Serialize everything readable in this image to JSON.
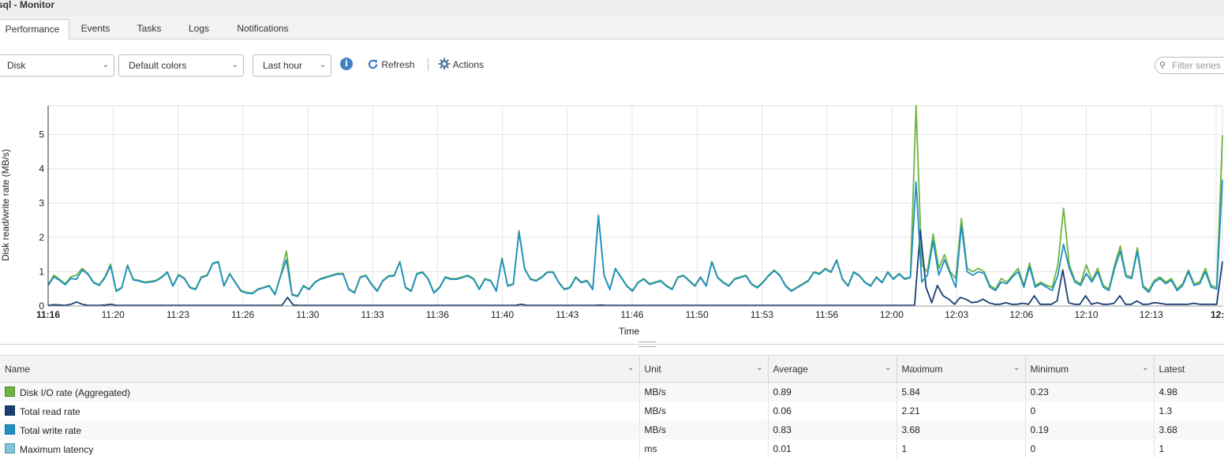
{
  "window": {
    "title": "sql - Monitor"
  },
  "tabs": [
    {
      "label": "Performance",
      "active": true
    },
    {
      "label": "Events",
      "active": false
    },
    {
      "label": "Tasks",
      "active": false
    },
    {
      "label": "Logs",
      "active": false
    },
    {
      "label": "Notifications",
      "active": false
    }
  ],
  "toolbar": {
    "metric_select": "Disk",
    "colors_select": "Default colors",
    "period_select": "Last hour",
    "refresh_label": "Refresh",
    "actions_label": "Actions",
    "filter_placeholder": "Filter series"
  },
  "chart_data": {
    "type": "line",
    "ylabel": "Disk read/write rate (MB/s)",
    "xlabel": "Time",
    "ylim": [
      0,
      5.84
    ],
    "y_ticks": [
      0,
      1,
      2,
      3,
      4,
      5
    ],
    "x_tick_labels": [
      "11:16",
      "11:20",
      "11:23",
      "11:26",
      "11:30",
      "11:33",
      "11:36",
      "11:40",
      "11:43",
      "11:46",
      "11:50",
      "11:53",
      "11:56",
      "12:00",
      "12:03",
      "12:06",
      "12:10",
      "12:13",
      "12:"
    ],
    "grid": true,
    "series": [
      {
        "name": "Disk I/O rate (Aggregated)",
        "color": "#6db33f",
        "values": [
          0.62,
          0.9,
          0.78,
          0.65,
          0.85,
          0.9,
          1.1,
          0.95,
          0.7,
          0.62,
          0.85,
          1.22,
          0.45,
          0.55,
          1.2,
          0.78,
          0.75,
          0.7,
          0.72,
          0.75,
          0.85,
          1.0,
          0.6,
          0.92,
          0.82,
          0.55,
          0.5,
          0.85,
          0.9,
          1.25,
          1.3,
          0.6,
          0.95,
          0.7,
          0.45,
          0.4,
          0.38,
          0.5,
          0.55,
          0.6,
          0.35,
          0.9,
          1.6,
          0.35,
          0.3,
          0.6,
          0.5,
          0.7,
          0.8,
          0.85,
          0.9,
          0.95,
          0.95,
          0.5,
          0.4,
          0.85,
          0.9,
          0.65,
          0.45,
          0.75,
          0.88,
          0.9,
          1.3,
          0.55,
          0.45,
          0.95,
          1.0,
          0.8,
          0.4,
          0.55,
          0.85,
          0.8,
          0.8,
          0.85,
          0.9,
          0.8,
          0.5,
          0.8,
          0.75,
          0.45,
          1.4,
          0.6,
          0.65,
          2.2,
          1.1,
          0.8,
          0.75,
          0.85,
          1.0,
          1.0,
          0.7,
          0.5,
          0.55,
          0.85,
          0.7,
          0.75,
          0.5,
          2.65,
          0.9,
          0.5,
          1.1,
          0.85,
          0.6,
          0.45,
          0.7,
          0.8,
          0.65,
          0.7,
          0.75,
          0.6,
          0.5,
          0.85,
          0.9,
          0.75,
          0.6,
          0.85,
          0.6,
          1.3,
          0.85,
          0.7,
          0.6,
          0.8,
          0.85,
          0.9,
          0.65,
          0.55,
          0.7,
          0.9,
          1.05,
          0.9,
          0.6,
          0.45,
          0.55,
          0.65,
          0.75,
          1.0,
          0.95,
          1.1,
          1.0,
          1.35,
          0.8,
          0.6,
          1.0,
          0.9,
          0.7,
          0.6,
          0.85,
          0.7,
          1.0,
          0.8,
          0.95,
          0.8,
          0.85,
          5.84,
          1.2,
          1.0,
          2.1,
          1.1,
          1.5,
          1.0,
          0.8,
          2.55,
          1.1,
          1.0,
          1.1,
          1.0,
          0.6,
          0.5,
          0.8,
          0.7,
          0.9,
          1.1,
          0.6,
          1.25,
          0.6,
          0.7,
          0.6,
          0.55,
          1.2,
          2.85,
          1.2,
          0.75,
          0.65,
          1.2,
          0.75,
          1.1,
          0.6,
          0.5,
          1.2,
          1.75,
          0.9,
          0.85,
          1.7,
          0.6,
          0.45,
          0.75,
          0.85,
          0.7,
          0.8,
          0.5,
          0.65,
          1.05,
          0.65,
          0.7,
          1.1,
          0.6,
          0.55,
          4.98
        ]
      },
      {
        "name": "Total read rate",
        "color": "#1a3f73",
        "values": [
          0.02,
          0.04,
          0.03,
          0.02,
          0.05,
          0.12,
          0.05,
          0.02,
          0.02,
          0.02,
          0.03,
          0.05,
          0.02,
          0.02,
          0.02,
          0.02,
          0.02,
          0.02,
          0.02,
          0.02,
          0.02,
          0.02,
          0.02,
          0.02,
          0.02,
          0.02,
          0.02,
          0.02,
          0.02,
          0.02,
          0.02,
          0.02,
          0.02,
          0.02,
          0.02,
          0.02,
          0.02,
          0.02,
          0.02,
          0.02,
          0.02,
          0.02,
          0.25,
          0.03,
          0.02,
          0.02,
          0.02,
          0.02,
          0.02,
          0.02,
          0.02,
          0.02,
          0.02,
          0.02,
          0.02,
          0.02,
          0.02,
          0.02,
          0.02,
          0.02,
          0.02,
          0.02,
          0.02,
          0.02,
          0.02,
          0.02,
          0.02,
          0.02,
          0.02,
          0.02,
          0.02,
          0.02,
          0.02,
          0.02,
          0.02,
          0.02,
          0.02,
          0.02,
          0.02,
          0.02,
          0.02,
          0.02,
          0.02,
          0.05,
          0.02,
          0.02,
          0.02,
          0.02,
          0.02,
          0.02,
          0.02,
          0.02,
          0.02,
          0.02,
          0.02,
          0.02,
          0.02,
          0.03,
          0.02,
          0.02,
          0.02,
          0.02,
          0.02,
          0.02,
          0.02,
          0.02,
          0.02,
          0.02,
          0.02,
          0.02,
          0.02,
          0.02,
          0.02,
          0.02,
          0.02,
          0.02,
          0.02,
          0.02,
          0.02,
          0.02,
          0.02,
          0.02,
          0.02,
          0.02,
          0.02,
          0.02,
          0.02,
          0.02,
          0.02,
          0.02,
          0.02,
          0.02,
          0.02,
          0.02,
          0.02,
          0.02,
          0.02,
          0.02,
          0.02,
          0.02,
          0.02,
          0.02,
          0.02,
          0.02,
          0.02,
          0.02,
          0.02,
          0.02,
          0.02,
          0.02,
          0.02,
          0.02,
          0.02,
          2.21,
          0.55,
          0.1,
          0.6,
          0.3,
          0.2,
          0.05,
          0.25,
          0.2,
          0.1,
          0.12,
          0.2,
          0.1,
          0.05,
          0.05,
          0.1,
          0.05,
          0.05,
          0.08,
          0.05,
          0.3,
          0.05,
          0.05,
          0.05,
          0.15,
          1.05,
          0.1,
          0.05,
          0.05,
          0.3,
          0.05,
          0.1,
          0.05,
          0.05,
          0.08,
          0.3,
          0.05,
          0.05,
          0.15,
          0.05,
          0.05,
          0.1,
          0.08,
          0.05,
          0.05,
          0.05,
          0.05,
          0.05,
          0.08,
          0.05,
          0.05,
          0.05,
          0.05,
          1.3
        ]
      },
      {
        "name": "Total write rate",
        "color": "#1e8fc6",
        "values": [
          0.6,
          0.85,
          0.75,
          0.62,
          0.8,
          0.78,
          1.05,
          0.93,
          0.68,
          0.6,
          0.82,
          1.17,
          0.43,
          0.53,
          1.18,
          0.76,
          0.73,
          0.68,
          0.7,
          0.73,
          0.83,
          0.98,
          0.58,
          0.9,
          0.8,
          0.53,
          0.48,
          0.83,
          0.88,
          1.23,
          1.28,
          0.58,
          0.93,
          0.68,
          0.43,
          0.38,
          0.36,
          0.48,
          0.53,
          0.58,
          0.33,
          0.88,
          1.35,
          0.32,
          0.28,
          0.58,
          0.48,
          0.68,
          0.78,
          0.83,
          0.88,
          0.93,
          0.93,
          0.48,
          0.38,
          0.83,
          0.88,
          0.63,
          0.43,
          0.73,
          0.86,
          0.88,
          1.28,
          0.53,
          0.43,
          0.93,
          0.98,
          0.78,
          0.38,
          0.53,
          0.83,
          0.78,
          0.78,
          0.83,
          0.88,
          0.78,
          0.48,
          0.78,
          0.73,
          0.43,
          1.38,
          0.58,
          0.63,
          2.15,
          1.08,
          0.78,
          0.73,
          0.83,
          0.98,
          0.98,
          0.68,
          0.48,
          0.53,
          0.83,
          0.68,
          0.73,
          0.48,
          2.62,
          0.88,
          0.48,
          1.08,
          0.83,
          0.58,
          0.43,
          0.68,
          0.78,
          0.63,
          0.68,
          0.73,
          0.58,
          0.48,
          0.83,
          0.88,
          0.73,
          0.58,
          0.83,
          0.58,
          1.28,
          0.83,
          0.68,
          0.58,
          0.78,
          0.83,
          0.88,
          0.63,
          0.53,
          0.68,
          0.88,
          1.03,
          0.88,
          0.58,
          0.43,
          0.53,
          0.63,
          0.73,
          0.98,
          0.93,
          1.08,
          0.98,
          1.33,
          0.78,
          0.58,
          0.98,
          0.88,
          0.68,
          0.58,
          0.83,
          0.68,
          0.98,
          0.78,
          0.93,
          0.78,
          0.83,
          3.62,
          0.7,
          0.9,
          1.9,
          0.9,
          1.35,
          0.95,
          0.55,
          2.35,
          1.0,
          0.9,
          1.0,
          0.95,
          0.55,
          0.45,
          0.7,
          0.65,
          0.85,
          1.0,
          0.55,
          1.15,
          0.55,
          0.65,
          0.55,
          0.45,
          0.9,
          1.8,
          1.1,
          0.7,
          0.6,
          0.95,
          0.7,
          1.0,
          0.55,
          0.45,
          1.1,
          1.6,
          0.85,
          0.8,
          1.6,
          0.55,
          0.4,
          0.7,
          0.8,
          0.65,
          0.75,
          0.45,
          0.6,
          1.0,
          0.6,
          0.65,
          1.0,
          0.55,
          0.5,
          3.68
        ]
      }
    ]
  },
  "table": {
    "columns": [
      "Name",
      "Unit",
      "Average",
      "Maximum",
      "Minimum",
      "Latest"
    ],
    "rows": [
      {
        "color": "#6db33f",
        "cells": [
          "Disk I/O rate (Aggregated)",
          "MB/s",
          "0.89",
          "5.84",
          "0.23",
          "4.98"
        ]
      },
      {
        "color": "#1a3f73",
        "cells": [
          "Total read rate",
          "MB/s",
          "0.06",
          "2.21",
          "0",
          "1.3"
        ]
      },
      {
        "color": "#1e8fc6",
        "cells": [
          "Total write rate",
          "MB/s",
          "0.83",
          "3.68",
          "0.19",
          "3.68"
        ]
      },
      {
        "color": "#7fc4d9",
        "cells": [
          "Maximum latency",
          "ms",
          "0.01",
          "1",
          "0",
          "1"
        ]
      }
    ]
  }
}
